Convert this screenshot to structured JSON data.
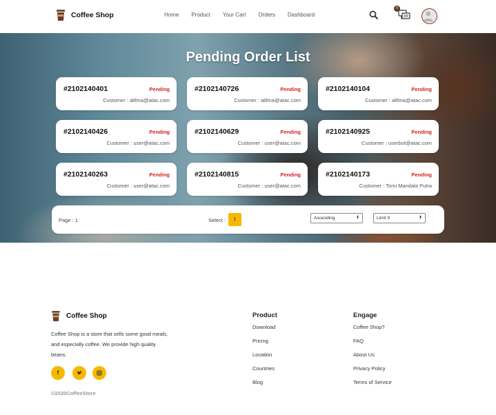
{
  "brand": {
    "name": "Coffee Shop",
    "icon": "coffee-cup-icon"
  },
  "nav": {
    "items": [
      "Home",
      "Product",
      "Your Cart",
      "Orders",
      "Dashboard"
    ]
  },
  "header_icons": {
    "search": "search-icon",
    "chat": "chat-icon",
    "chat_badge": "9",
    "avatar": "user-avatar"
  },
  "hero": {
    "title": "Pending Order List"
  },
  "orders": [
    {
      "id": "#2102140401",
      "status": "Pending",
      "customer": "Customer : alifma@atac.com"
    },
    {
      "id": "#2102140726",
      "status": "Pending",
      "customer": "Customer : alifma@atac.com"
    },
    {
      "id": "#2102140104",
      "status": "Pending",
      "customer": "Customer : alifma@atac.com"
    },
    {
      "id": "#2102140426",
      "status": "Pending",
      "customer": "Customer : user@atac.com"
    },
    {
      "id": "#2102140629",
      "status": "Pending",
      "customer": "Customer : user@atac.com"
    },
    {
      "id": "#2102140925",
      "status": "Pending",
      "customer": "Customer : userbot@atac.com"
    },
    {
      "id": "#2102140263",
      "status": "Pending",
      "customer": "Customer : user@atac.com"
    },
    {
      "id": "#2102140815",
      "status": "Pending",
      "customer": "Customer : user@atac.com"
    },
    {
      "id": "#2102140173",
      "status": "Pending",
      "customer": "Customer : Tomi Mandala Putra"
    }
  ],
  "pager": {
    "page_label": "Page : 1",
    "select_label": "Select :",
    "current_page": "1",
    "sort_value": "Ascending",
    "limit_value": "Limit 9"
  },
  "colors": {
    "accent": "#f5b800",
    "status": "#d42020"
  },
  "footer": {
    "brand": "Coffee Shop",
    "description": "Coffee Shop is a store that sells some good meals, and especially coffee. We provide high quality beans.",
    "social": [
      "facebook-icon",
      "twitter-icon",
      "instagram-icon"
    ],
    "copyright": "©2020CoffeeStore",
    "product": {
      "title": "Product",
      "links": [
        "Download",
        "Pricing",
        "Location",
        "Countries",
        "Blog"
      ]
    },
    "engage": {
      "title": "Engage",
      "links": [
        "Coffee Shop?",
        "FAQ",
        "About Us",
        "Privacy Policy",
        "Terms of Service"
      ]
    }
  }
}
